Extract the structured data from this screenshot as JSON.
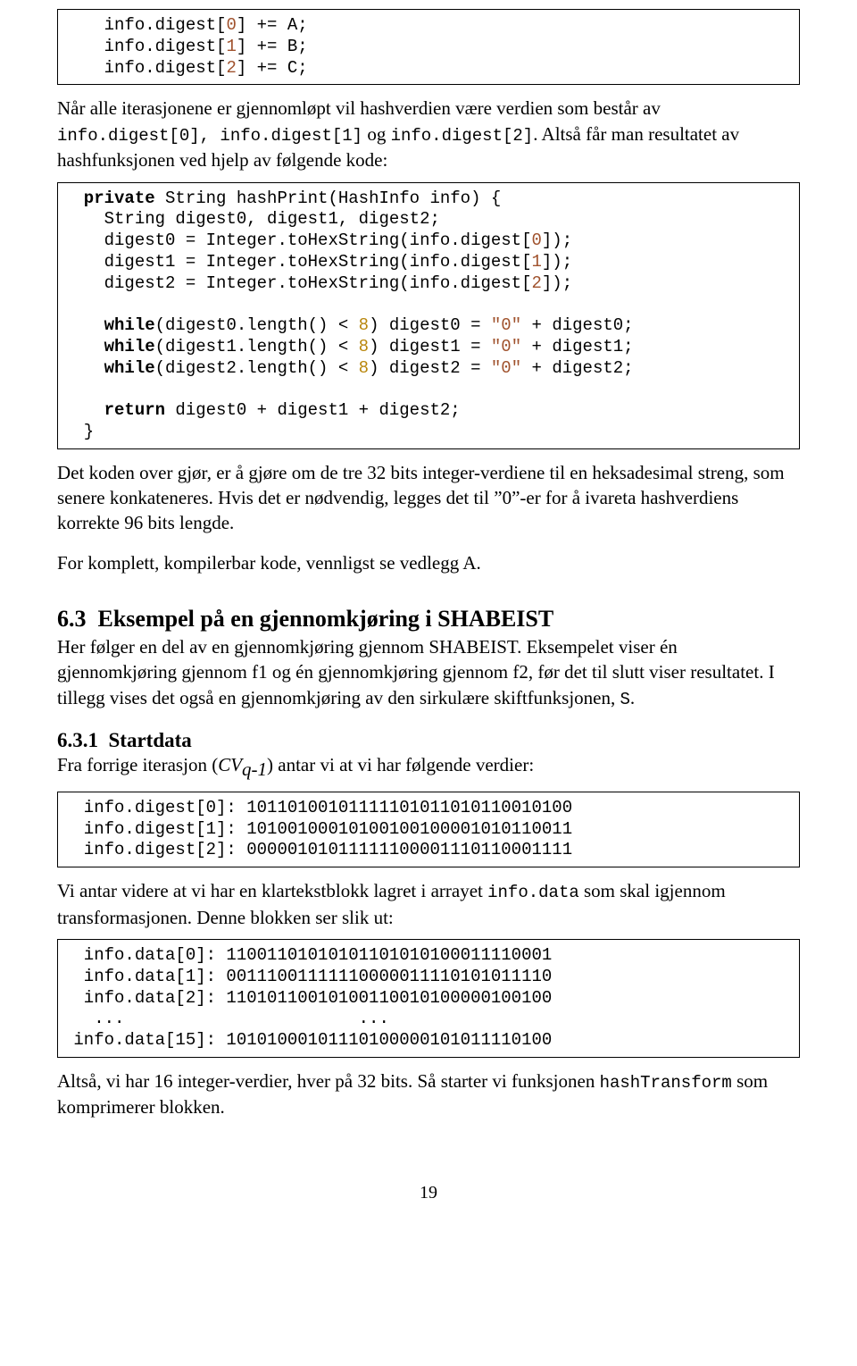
{
  "code1": {
    "l0": "    info.digest[0] += A;",
    "l0_pre": "    info.digest[",
    "l0_idx": "0",
    "l0_post": "] += A;",
    "l1_pre": "    info.digest[",
    "l1_idx": "1",
    "l1_post": "] += B;",
    "l2_pre": "    info.digest[",
    "l2_idx": "2",
    "l2_post": "] += C;"
  },
  "para1_a": "Når alle iterasjonene er gjennomløpt vil hashverdien være verdien som består av",
  "para1_b_mono": "info.digest[0], info.digest[1]",
  "para1_b_mid": " og ",
  "para1_b_mono2": "info.digest[2]",
  "para1_c": ". Altså får man resultatet av hashfunksjonen ved hjelp av følgende kode:",
  "code2": {
    "l0_priv": "  private",
    "l0_rest": " String hashPrint(HashInfo info) {",
    "l1": "    String digest0, digest1, digest2;",
    "l2a": "    digest0 = Integer.toHexString(info.digest[",
    "l2i": "0",
    "l2b": "]);",
    "l3a": "    digest1 = Integer.toHexString(info.digest[",
    "l3i": "1",
    "l3b": "]);",
    "l4a": "    digest2 = Integer.toHexString(info.digest[",
    "l4i": "2",
    "l4b": "]);",
    "blank": " ",
    "l5_while": "    while",
    "l5a": "(digest0.length() < ",
    "l5n": "8",
    "l5b": ") digest0 = ",
    "l5s": "\"0\"",
    "l5c": " + digest0;",
    "l6_while": "    while",
    "l6a": "(digest1.length() < ",
    "l6n": "8",
    "l6b": ") digest1 = ",
    "l6s": "\"0\"",
    "l6c": " + digest1;",
    "l7_while": "    while",
    "l7a": "(digest2.length() < ",
    "l7n": "8",
    "l7b": ") digest2 = ",
    "l7s": "\"0\"",
    "l7c": " + digest2;",
    "l8_ret": "    return",
    "l8a": " digest0 + digest1 + digest2;",
    "l9": "  }"
  },
  "para2": "Det koden over gjør, er å gjøre om de tre 32 bits integer-verdiene til en heksadesimal streng, som senere konkateneres. Hvis det er nødvendig, legges det til ”0”-er for å ivareta hashverdiens korrekte 96 bits lengde.",
  "para3": "For komplett, kompilerbar kode, vennligst se vedlegg A.",
  "sec63_num": "6.3",
  "sec63_title": "Eksempel på en gjennomkjøring i SHABEIST",
  "para4": "Her følger en del av en gjennomkjøring gjennom SHABEIST. Eksempelet viser én gjennomkjøring gjennom f1 og én gjennomkjøring gjennom f2, før det til slutt viser resultatet. I tillegg vises det også en gjennomkjøring av den sirkulære skiftfunksjonen, ",
  "para4_mono": "S",
  "para4_end": ".",
  "sec631_num": "6.3.1",
  "sec631_title": "Startdata",
  "para5_a": "Fra forrige iterasjon (",
  "para5_cv": "CV",
  "para5_sub": "q-1",
  "para5_b": ") antar vi at vi har følgende verdier:",
  "code3": {
    "l0": "  info.digest[0]: 10110100101111101011010110010100",
    "l1": "  info.digest[1]: 10100100010100100100001010110011",
    "l2": "  info.digest[2]: 00000101011111100001110110001111"
  },
  "para6_a": "Vi antar videre at vi har en klartekstblokk lagret i arrayet ",
  "para6_mono": "info.data",
  "para6_b": " som skal igjennom transformasjonen. Denne blokken ser slik ut:",
  "code4": {
    "l0": "  info.data[0]: 11001101010101101010100011110001",
    "l1": "  info.data[1]: 00111001111110000011110101011110",
    "l2": "  info.data[2]: 11010110010100110010100000100100",
    "dots": "   ...                       ...",
    "l3": " info.data[15]: 10101000101110100000101011110100"
  },
  "para7_a": "Altså, vi har 16 integer-verdier, hver på 32 bits. Så starter vi funksjonen ",
  "para7_mono": "hashTransform",
  "para7_b": " som komprimerer blokken.",
  "pagenum": "19"
}
